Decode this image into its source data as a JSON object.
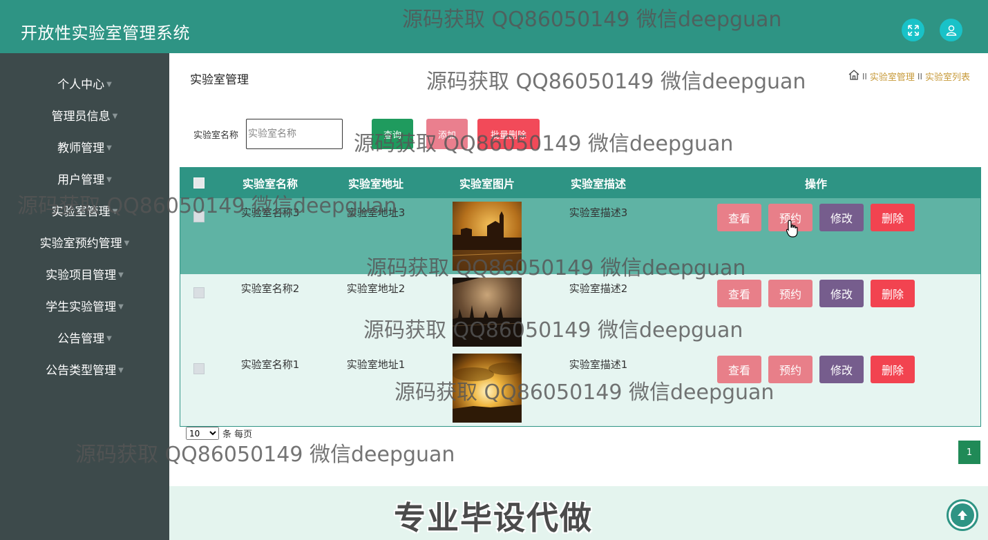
{
  "header": {
    "title": "开放性实验室管理系统",
    "expand_icon": "expand-icon",
    "user_icon": "user-icon",
    "color": "#2e9484"
  },
  "sidebar": {
    "items": [
      {
        "label": "个人中心"
      },
      {
        "label": "管理员信息"
      },
      {
        "label": "教师管理"
      },
      {
        "label": "用户管理"
      },
      {
        "label": "实验室管理"
      },
      {
        "label": "实验室预约管理"
      },
      {
        "label": "实验项目管理"
      },
      {
        "label": "学生实验管理"
      },
      {
        "label": "公告管理"
      },
      {
        "label": "公告类型管理"
      }
    ]
  },
  "main": {
    "page_title": "实验室管理",
    "breadcrumb": [
      "实验室管理",
      "实验室列表"
    ],
    "breadcrumb_sep": "II",
    "search": {
      "label": "实验室名称",
      "placeholder": "实验室名称",
      "value": ""
    },
    "buttons": {
      "query": "查询",
      "add": "添加",
      "batch_delete": "批量删除"
    },
    "table": {
      "headers": [
        "实验室名称",
        "实验室地址",
        "实验室图片",
        "实验室描述",
        "操作"
      ],
      "rows": [
        {
          "name": "实验室名称3",
          "address": "实验室地址3",
          "desc": "实验室描述3",
          "image": "city-gate-sunset"
        },
        {
          "name": "实验室名称2",
          "address": "实验室地址2",
          "desc": "实验室描述2",
          "image": "dusk-skyline"
        },
        {
          "name": "实验室名称1",
          "address": "实验室地址1",
          "desc": "实验室描述1",
          "image": "cloudy-sunset"
        }
      ],
      "actions": {
        "view": "查看",
        "book": "预约",
        "edit": "修改",
        "delete": "删除"
      }
    },
    "pager": {
      "per_page": "10",
      "per_page_label": "条 每页",
      "current_page": "1"
    }
  },
  "footer": {
    "text": "专业毕设代做"
  },
  "watermark": "源码获取 QQ86050149 微信deepguan"
}
